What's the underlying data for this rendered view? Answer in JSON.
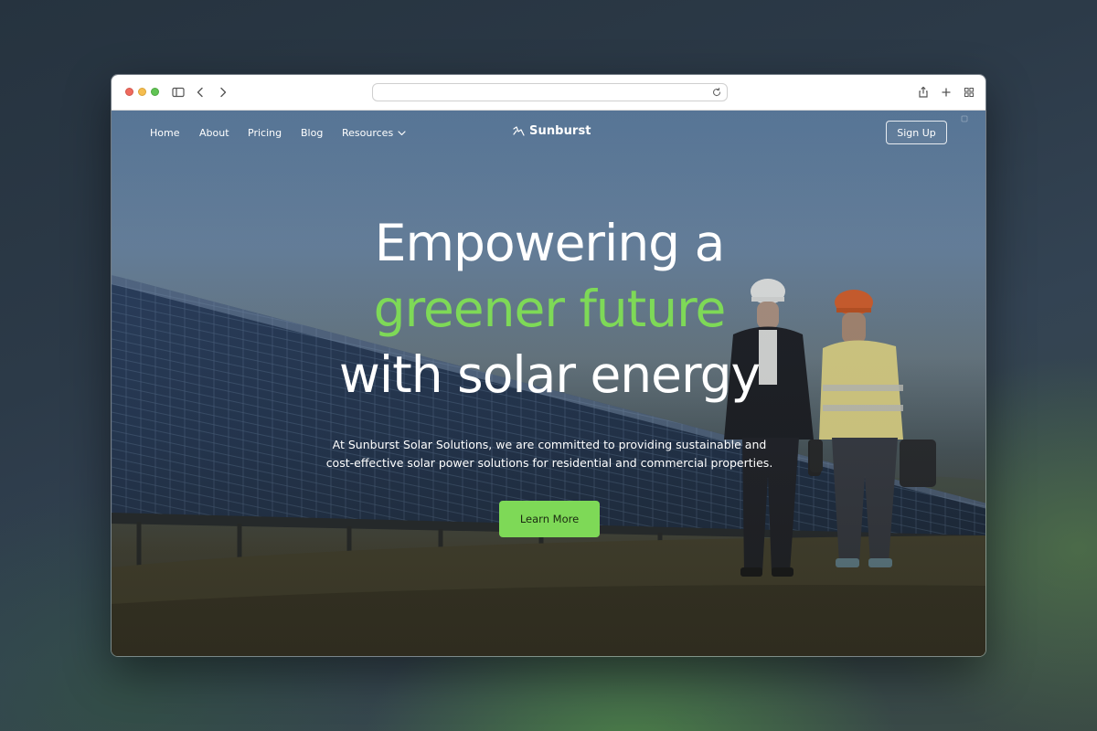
{
  "browser": {
    "url": "",
    "buttons": [
      "sidebar-toggle",
      "back",
      "forward",
      "reload",
      "share",
      "new-tab",
      "tab-overview"
    ]
  },
  "nav": {
    "links": [
      "Home",
      "About",
      "Pricing",
      "Blog"
    ],
    "resources_label": "Resources",
    "logo_text": "Sunburst",
    "signup_label": "Sign Up"
  },
  "hero": {
    "line1": "Empowering a",
    "line2": "greener future",
    "line3": "with solar energy",
    "subtext_line1": "At Sunburst Solar Solutions, we are committed to providing sustainable and",
    "subtext_line2": "cost-effective solar power solutions for residential and commercial properties.",
    "cta_label": "Learn More"
  },
  "colors": {
    "accent": "#7ed957",
    "text_on_dark": "#ffffff"
  }
}
